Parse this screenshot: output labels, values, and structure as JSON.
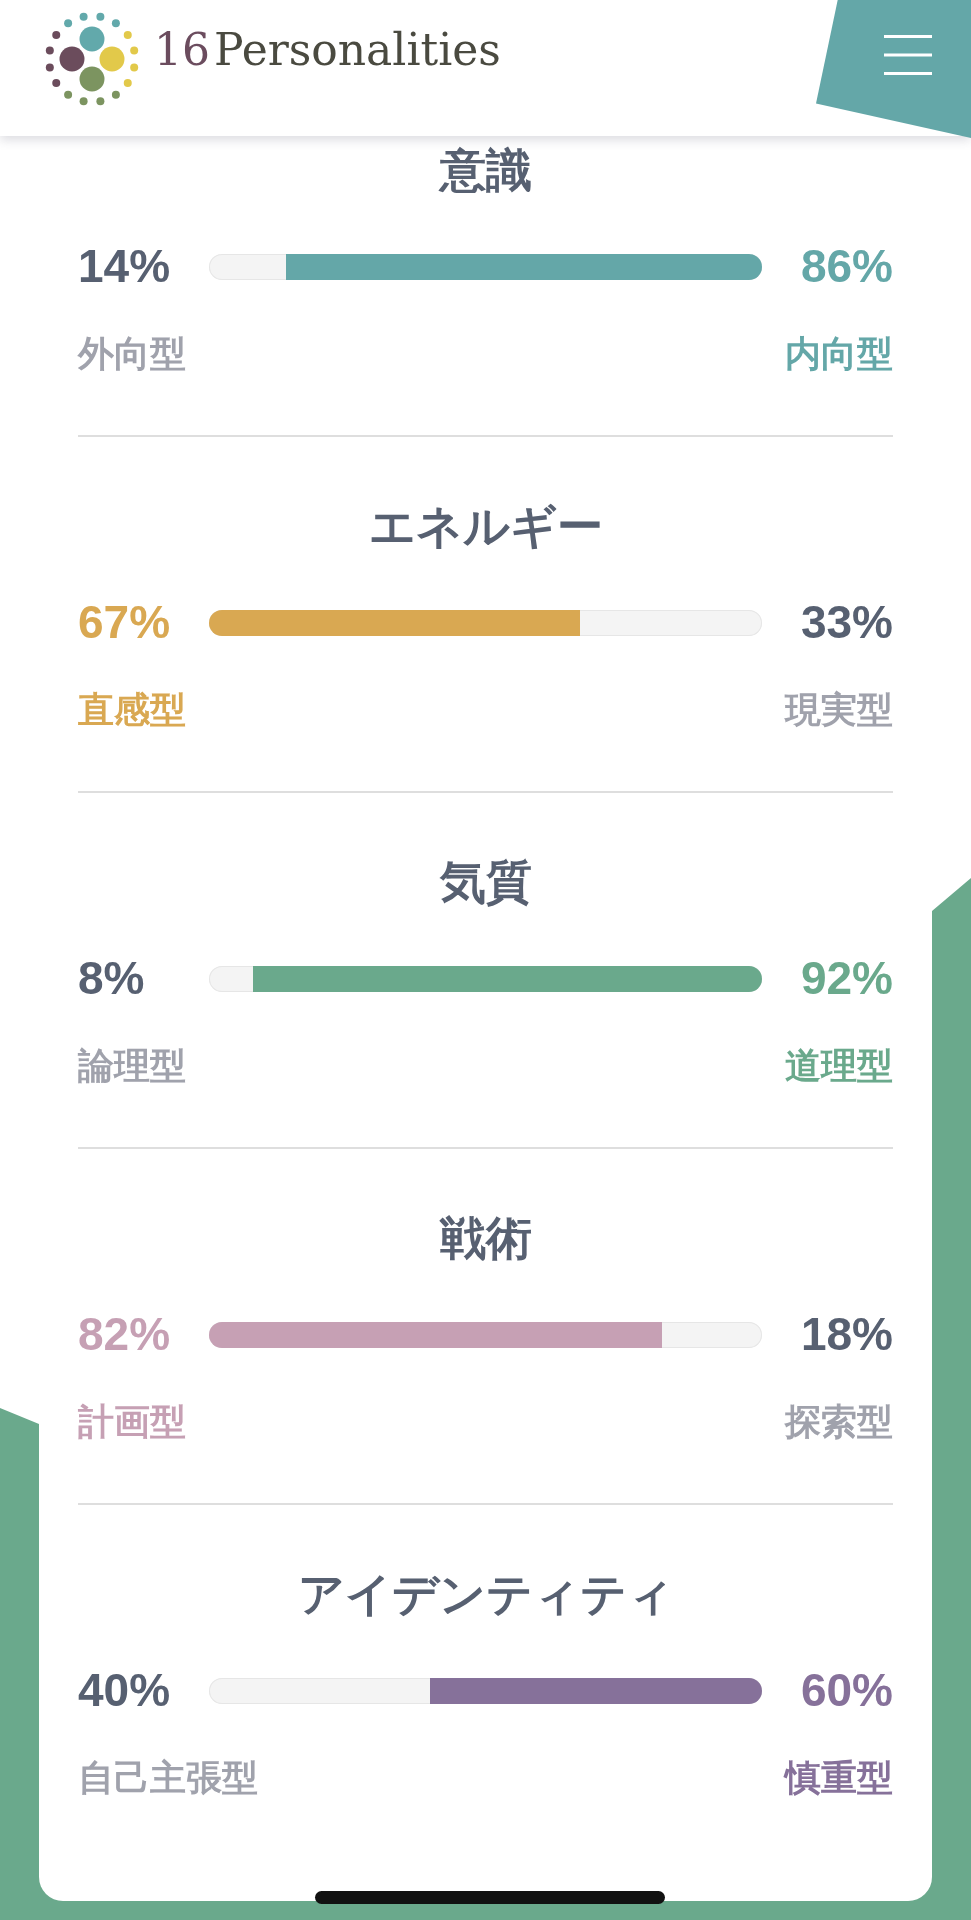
{
  "header": {
    "logo": {
      "number": "16",
      "name": "Personalities"
    }
  },
  "sections": [
    {
      "title": "意識",
      "color": "#64a7a8",
      "meter": {
        "level": 0.86
      },
      "traits": [
        {
          "percent": "14%",
          "label": "外向型",
          "dominant": false
        },
        {
          "percent": "86%",
          "label": "内向型",
          "dominant": true
        }
      ]
    },
    {
      "title": "エネルギー",
      "color": "#d9a852",
      "meter": {
        "level": 0.67
      },
      "traits": [
        {
          "percent": "67%",
          "label": "直感型",
          "dominant": true
        },
        {
          "percent": "33%",
          "label": "現実型",
          "dominant": false
        }
      ]
    },
    {
      "title": "気質",
      "color": "#6aa98c",
      "meter": {
        "level": 0.92
      },
      "traits": [
        {
          "percent": "8%",
          "label": "論理型",
          "dominant": false
        },
        {
          "percent": "92%",
          "label": "道理型",
          "dominant": true
        }
      ]
    },
    {
      "title": "戦術",
      "color": "#c6a0b4",
      "meter": {
        "level": 0.82
      },
      "traits": [
        {
          "percent": "82%",
          "label": "計画型",
          "dominant": true
        },
        {
          "percent": "18%",
          "label": "探索型",
          "dominant": false
        }
      ]
    },
    {
      "title": "アイデンティティ",
      "color": "#86719a",
      "meter": {
        "level": 0.6
      },
      "traits": [
        {
          "percent": "40%",
          "label": "自己主張型",
          "dominant": false
        },
        {
          "percent": "60%",
          "label": "慎重型",
          "dominant": true
        }
      ]
    }
  ]
}
